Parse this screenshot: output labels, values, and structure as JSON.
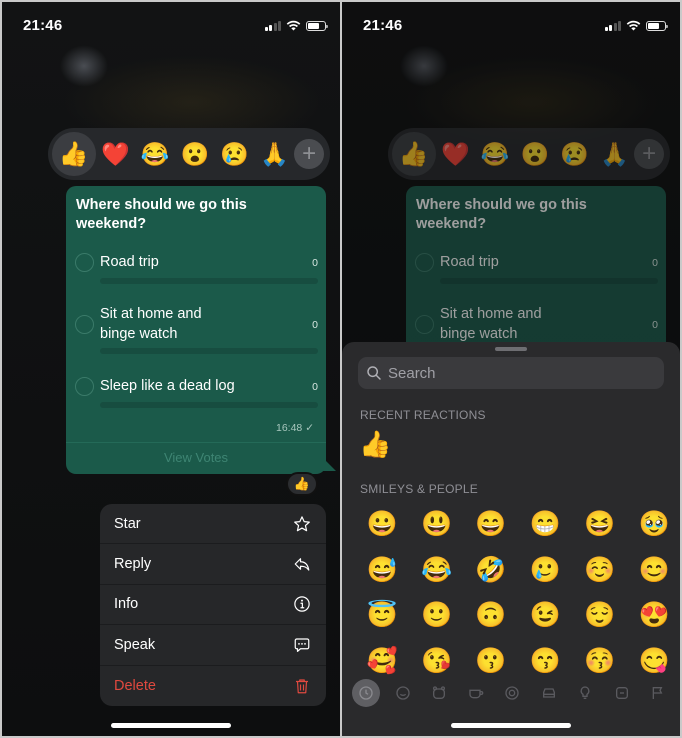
{
  "status": {
    "time": "21:46"
  },
  "reactions": {
    "items": [
      {
        "name": "thumbs-up",
        "emoji": "👍",
        "selected": true
      },
      {
        "name": "red-heart",
        "emoji": "❤️"
      },
      {
        "name": "tears-of-joy",
        "emoji": "😂"
      },
      {
        "name": "open-mouth",
        "emoji": "😮"
      },
      {
        "name": "crying",
        "emoji": "😢"
      },
      {
        "name": "folded-hands",
        "emoji": "🙏"
      }
    ],
    "more": "+"
  },
  "poll": {
    "question": "Where should we go this weekend?",
    "options": [
      {
        "label": "Road trip",
        "votes": "0"
      },
      {
        "label": "Sit at home and binge watch",
        "votes": "0"
      },
      {
        "label": "Sleep like a dead log",
        "votes": "0"
      }
    ],
    "time": "16:48 ✓",
    "view_votes": "View Votes",
    "reaction_badge": "👍"
  },
  "menu": {
    "items": [
      {
        "label": "Star",
        "icon": "star-icon"
      },
      {
        "label": "Reply",
        "icon": "reply-icon"
      },
      {
        "label": "Info",
        "icon": "info-icon"
      },
      {
        "label": "Speak",
        "icon": "speech-bubble-icon"
      },
      {
        "label": "Delete",
        "icon": "trash-icon",
        "danger": true
      }
    ]
  },
  "picker": {
    "search_placeholder": "Search",
    "recent_title": "RECENT REACTIONS",
    "recent": [
      "👍"
    ],
    "smileys_title": "SMILEYS & PEOPLE",
    "smileys": [
      "😀",
      "😃",
      "😄",
      "😁",
      "😆",
      "🥹",
      "😅",
      "😂",
      "🤣",
      "🥲",
      "☺️",
      "😊",
      "😇",
      "🙂",
      "🙃",
      "😉",
      "😌",
      "😍",
      "🥰",
      "😘",
      "😗",
      "😙",
      "😚",
      "😋"
    ],
    "categories": [
      "recent",
      "smileys",
      "animals",
      "food",
      "activity",
      "travel",
      "objects",
      "symbols",
      "flags"
    ],
    "active_category": "recent"
  }
}
